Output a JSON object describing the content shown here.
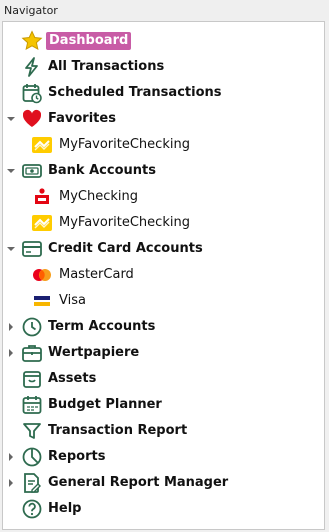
{
  "panel_title": "Navigator",
  "items": {
    "dashboard": "Dashboard",
    "all_transactions": "All Transactions",
    "scheduled_transactions": "Scheduled Transactions",
    "favorites": "Favorites",
    "fav_checking": "MyFavoriteChecking",
    "bank_accounts": "Bank Accounts",
    "my_checking": "MyChecking",
    "bank_fav_checking": "MyFavoriteChecking",
    "credit_card_accounts": "Credit Card Accounts",
    "mastercard": "MasterCard",
    "visa": "Visa",
    "term_accounts": "Term Accounts",
    "wertpapiere": "Wertpapiere",
    "assets": "Assets",
    "budget_planner": "Budget Planner",
    "transaction_report": "Transaction Report",
    "reports": "Reports",
    "general_report_manager": "General Report Manager",
    "help": "Help"
  },
  "icons": {
    "dashboard": "star-icon",
    "all_transactions": "lightning-icon",
    "scheduled_transactions": "calendar-clock-icon",
    "favorites": "heart-icon",
    "fav_checking": "bank-logo-icon",
    "bank_accounts": "banknote-icon",
    "my_checking": "sparkasse-logo-icon",
    "bank_fav_checking": "bank-logo-icon",
    "credit_card_accounts": "credit-card-icon",
    "mastercard": "mastercard-logo-icon",
    "visa": "visa-logo-icon",
    "term_accounts": "clock-icon",
    "wertpapiere": "briefcase-icon",
    "assets": "box-icon",
    "budget_planner": "calendar-icon",
    "transaction_report": "funnel-icon",
    "reports": "pie-chart-icon",
    "general_report_manager": "document-edit-icon",
    "help": "help-icon"
  },
  "colors": {
    "selection": "#c85ca6",
    "icon_green": "#2e6b4f",
    "star": "#f5c400",
    "heart": "#e0101e"
  }
}
